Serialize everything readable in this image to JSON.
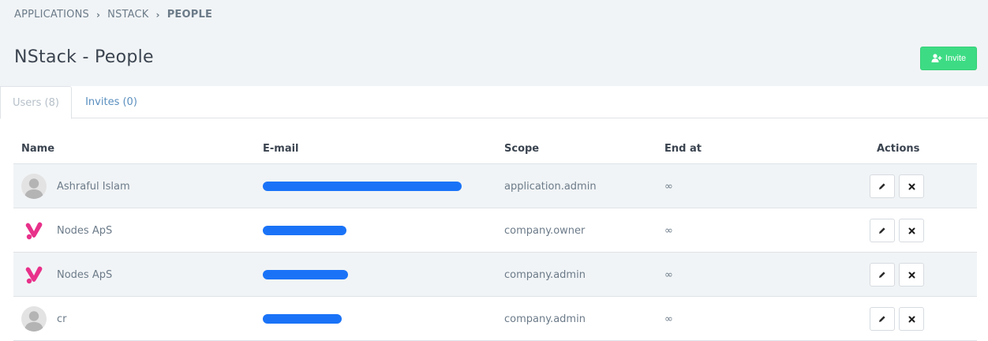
{
  "breadcrumb": [
    {
      "label": "APPLICATIONS"
    },
    {
      "label": "NSTACK"
    },
    {
      "label": "PEOPLE"
    }
  ],
  "breadcrumb_separator": "›",
  "page_title": "NStack - People",
  "invite_button": {
    "label": "Invite",
    "icon": "add-user-icon",
    "color": "#3ddc84"
  },
  "tabs": [
    {
      "label": "Users (8)",
      "active": true
    },
    {
      "label": "Invites (0)",
      "active": false
    }
  ],
  "table": {
    "headers": {
      "name": "Name",
      "email": "E-mail",
      "scope": "Scope",
      "end_at": "End at",
      "actions": "Actions"
    },
    "rows": [
      {
        "name": "Ashraful Islam",
        "avatar": "default-person-avatar",
        "email": "",
        "scope": "application.admin",
        "end_at": "∞"
      },
      {
        "name": "Nodes ApS",
        "avatar": "nodes-logo",
        "email": "",
        "scope": "company.owner",
        "end_at": "∞"
      },
      {
        "name": "Nodes ApS",
        "avatar": "nodes-logo",
        "email": "",
        "scope": "company.admin",
        "end_at": "∞"
      },
      {
        "name": "cr",
        "avatar": "default-person-avatar",
        "email": "",
        "scope": "company.admin",
        "end_at": "∞"
      }
    ]
  },
  "actions": {
    "edit_icon": "pencil-icon",
    "delete_icon": "close-icon"
  },
  "colors": {
    "header_bg": "#f1f4f6",
    "link": "#5a8fbf",
    "redaction": "#1a73f7",
    "logo": "#e8318a"
  }
}
